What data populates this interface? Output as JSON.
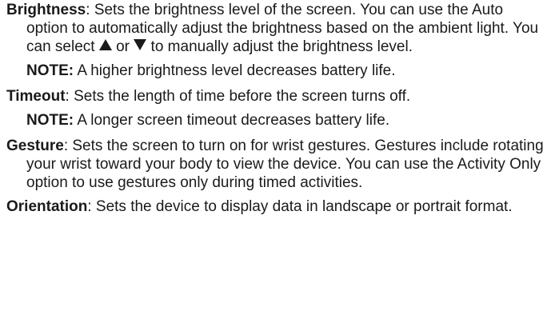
{
  "settings": [
    {
      "term": "Brightness",
      "sep": ": ",
      "desc_a": "Sets the brightness level of the screen. You can use the Auto option to automatically adjust the brightness based on the ambient light. You can select ",
      "desc_or": " or ",
      "desc_b": " to manually adjust the brightness level.",
      "note_label": "NOTE:",
      "note_text": " A higher brightness level decreases battery life."
    },
    {
      "term": "Timeout",
      "sep": ": ",
      "desc": "Sets the length of time before the screen turns off.",
      "note_label": "NOTE:",
      "note_text": " A longer screen timeout decreases battery life."
    },
    {
      "term": "Gesture",
      "sep": ": ",
      "desc": "Sets the screen to turn on for wrist gestures. Gestures include rotating your wrist toward your body to view the device. You can use the Activity Only option to use gestures only during timed activities."
    },
    {
      "term": "Orientation",
      "sep": ": ",
      "desc": "Sets the device to display data in landscape or portrait format."
    }
  ],
  "icons": {
    "up": "triangle-up-icon",
    "down": "triangle-down-icon"
  }
}
